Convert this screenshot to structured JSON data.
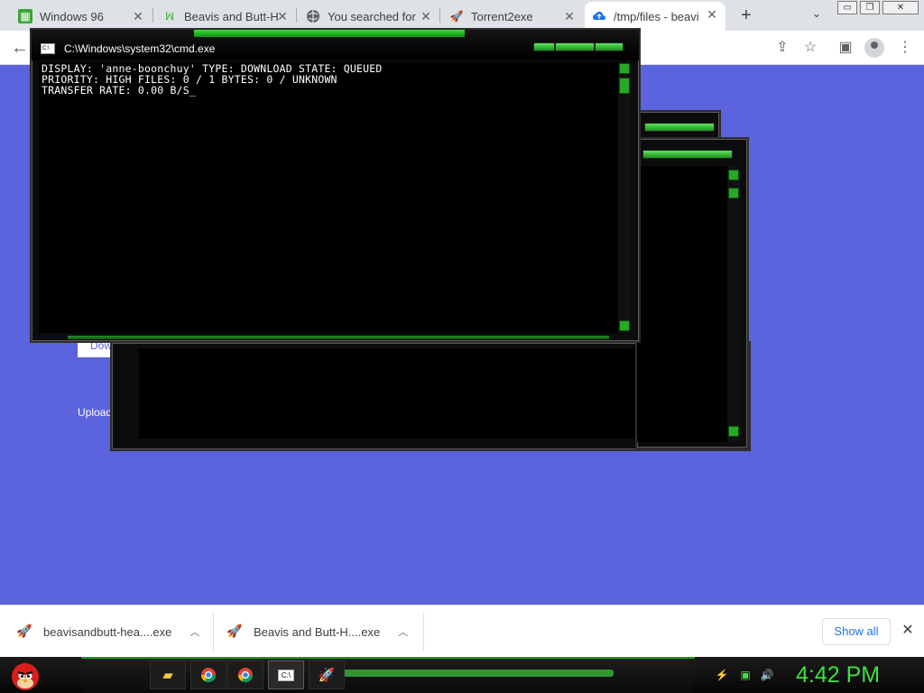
{
  "browser": {
    "tabs": [
      {
        "title": "Windows 96",
        "icon": "windows96-icon"
      },
      {
        "title": "Beavis and Butt-H",
        "icon": "site-icon"
      },
      {
        "title": "You searched for",
        "icon": "globe-icon"
      },
      {
        "title": "Torrent2exe",
        "icon": "rocket-icon"
      },
      {
        "title": "/tmp/files - beavi",
        "icon": "cloud-icon"
      }
    ],
    "active_tab_index": 4,
    "window_controls": [
      "minimize",
      "restore",
      "close"
    ]
  },
  "page": {
    "download_button_label": "Dow",
    "upload_link_label": "Upload"
  },
  "terminal": {
    "title": "C:\\Windows\\system32\\cmd.exe",
    "lines": [
      "DISPLAY: 'anne-boonchuy' TYPE: DOWNLOAD STATE: QUEUED",
      "PRIORITY: HIGH FILES: 0 / 1 BYTES: 0 / UNKNOWN",
      "TRANSFER RATE: 0.00 B/S_"
    ]
  },
  "downloads_bar": {
    "items": [
      {
        "name": "beavisandbutt-hea....exe"
      },
      {
        "name": "Beavis and Butt-H....exe"
      }
    ],
    "show_all_label": "Show all"
  },
  "taskbar": {
    "apps": [
      "folder-icon",
      "chrome-icon",
      "chrome-icon",
      "cmd-icon",
      "rocket-icon"
    ],
    "tray_icons": [
      "network-icon",
      "monitor-icon",
      "volume-icon"
    ],
    "clock": "4:42 PM"
  },
  "colors": {
    "page_background": "#5b63dd",
    "accent_green": "#3de03d",
    "link_blue": "#1a73e8"
  }
}
